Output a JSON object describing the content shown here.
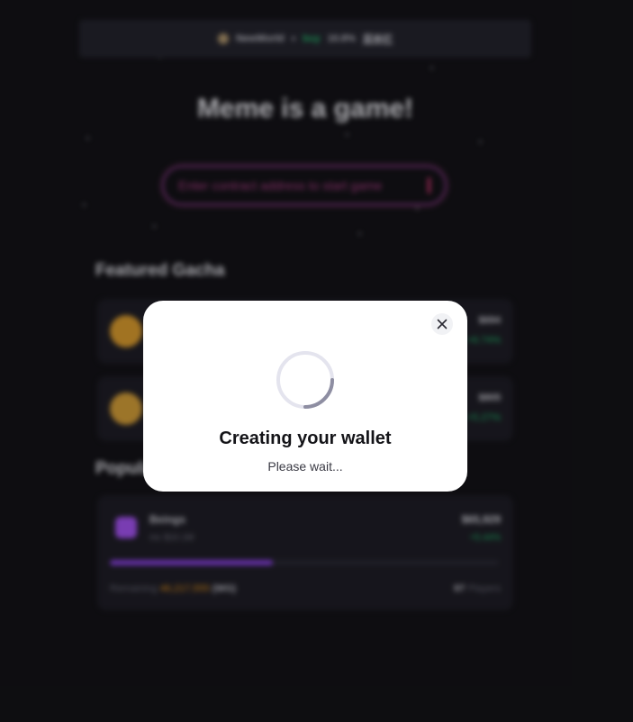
{
  "topbar": {
    "network_label": "NewWorld",
    "price_label": "buy",
    "price_change": "10.8%",
    "menu_label": "菜单栏"
  },
  "hero": {
    "title": "Meme is a game!",
    "search_placeholder": "Enter contract address to start game"
  },
  "featured": {
    "title": "Featured Gacha",
    "items": [
      {
        "value": "$694",
        "change": "+6.74%",
        "coin_color": "#e0a030"
      },
      {
        "value": "$805",
        "change": "+5.27%",
        "coin_color": "#d9a23a"
      }
    ]
  },
  "popular": {
    "title": "Popular",
    "card": {
      "name": "Beings",
      "subtitle": "mc $10.1M",
      "value": "$65,929",
      "change": "+5.44%",
      "progress": 0.42,
      "remaining_label": "Remaining",
      "remaining_amount": "46,217,555",
      "token": "(WG)",
      "players_count": "97",
      "players_label": "Players"
    }
  },
  "modal": {
    "title": "Creating your wallet",
    "subtitle": "Please wait..."
  },
  "colors": {
    "accent_green": "#22c06f",
    "accent_purple": "#8e44e8",
    "accent_orange": "#f19a1f",
    "background": "#141318"
  }
}
